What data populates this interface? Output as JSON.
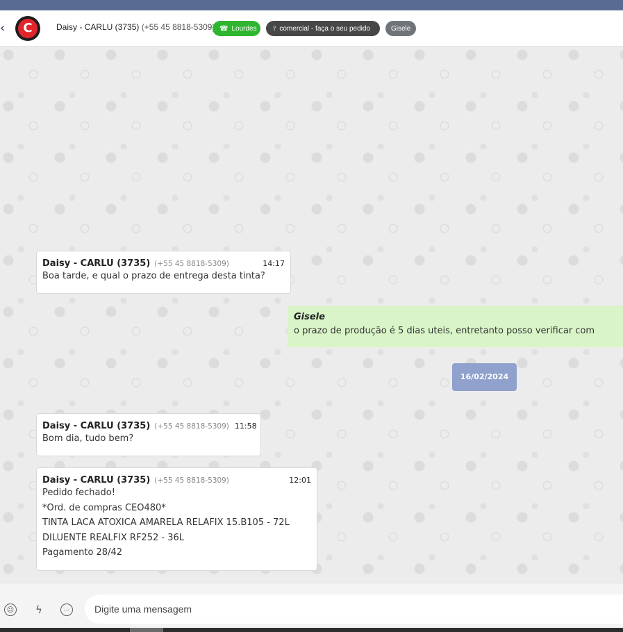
{
  "header": {
    "back_icon": "chevron-left-icon",
    "avatar_letter": "C",
    "contact_name": "Daisy - CARLU (3735)",
    "contact_phone": "(+55 45 8818-5309)",
    "channel_badge": "Lourdes",
    "channel_icon": "whatsapp-icon",
    "queue_badge": "comercial - faça o seu pedido",
    "queue_icon": "sitemap-icon",
    "agent_badge": "Gisele"
  },
  "messages": [
    {
      "sender": "Daisy - CARLU (3735)",
      "phone": "(+55 45 8818-5309)",
      "time": "14:17",
      "lines": [
        "Boa tarde, e qual o prazo de entrega desta tinta?"
      ]
    },
    {
      "author": "Gisele",
      "text": "o prazo de produção é 5 dias uteis, entretanto posso verificar com"
    },
    {
      "date": "16/02/2024"
    },
    {
      "sender": "Daisy - CARLU (3735)",
      "phone": "(+55 45 8818-5309)",
      "time": "11:58",
      "lines": [
        "Bom dia, tudo bem?"
      ]
    },
    {
      "sender": "Daisy - CARLU (3735)",
      "phone": "(+55 45 8818-5309)",
      "time": "12:01",
      "lines": [
        "Pedido fechado!",
        "*Ord. de compras CEO480*",
        "TINTA LACA ATOXICA AMARELA RELAFIX 15.B105 - 72L",
        "DILUENTE REALFIX RF252 - 36L",
        "Pagamento 28/42"
      ]
    }
  ],
  "composer": {
    "placeholder": "Digite uma mensagem",
    "icons": [
      "emoji-icon",
      "lightning-icon",
      "chat-bubble-icon"
    ]
  },
  "colors": {
    "topbar": "#5a6b93",
    "whatsapp_badge": "#2fb52f",
    "queue_badge": "#474747",
    "agent_badge": "#6f7479",
    "outgoing_bubble": "#d9f5c8",
    "date_chip": "#8fa1cc"
  }
}
